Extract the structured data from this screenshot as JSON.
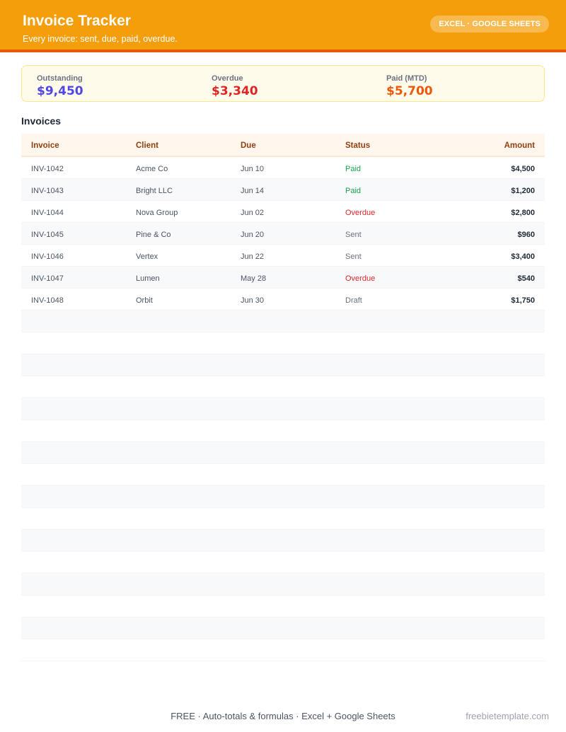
{
  "header": {
    "title": "Invoice Tracker",
    "subtitle": "Every invoice: sent, due, paid, overdue.",
    "badge": "EXCEL · GOOGLE SHEETS",
    "colors": {
      "bar": "#f59e0b",
      "stripe": "#ea580c"
    }
  },
  "summary": [
    {
      "label": "Outstanding",
      "value": "$9,450",
      "color": "#4f46e5"
    },
    {
      "label": "Overdue",
      "value": "$3,340",
      "color": "#dc2626"
    },
    {
      "label": "Paid (MTD)",
      "value": "$5,700",
      "color": "#ea580c"
    }
  ],
  "invoices": {
    "title": "Invoices",
    "columns": [
      "Invoice",
      "Client",
      "Due",
      "Status",
      "Amount"
    ],
    "status_colors": {
      "Paid": "#16a34a",
      "Overdue": "#dc2626",
      "Sent": "#6b7280",
      "Draft": "#6b7280"
    },
    "rows": [
      {
        "invoice": "INV-1042",
        "client": "Acme Co",
        "due": "Jun 10",
        "status": "Paid",
        "amount": "$4,500"
      },
      {
        "invoice": "INV-1043",
        "client": "Bright LLC",
        "due": "Jun 14",
        "status": "Paid",
        "amount": "$1,200"
      },
      {
        "invoice": "INV-1044",
        "client": "Nova Group",
        "due": "Jun 02",
        "status": "Overdue",
        "amount": "$2,800"
      },
      {
        "invoice": "INV-1045",
        "client": "Pine & Co",
        "due": "Jun 20",
        "status": "Sent",
        "amount": "$960"
      },
      {
        "invoice": "INV-1046",
        "client": "Vertex",
        "due": "Jun 22",
        "status": "Sent",
        "amount": "$3,400"
      },
      {
        "invoice": "INV-1047",
        "client": "Lumen",
        "due": "May 28",
        "status": "Overdue",
        "amount": "$540"
      },
      {
        "invoice": "INV-1048",
        "client": "Orbit",
        "due": "Jun 30",
        "status": "Draft",
        "amount": "$1,750"
      }
    ],
    "blank_rows": 16
  },
  "footer": {
    "features": "FREE  ·  Auto-totals & formulas  ·  Excel + Google Sheets",
    "brand": "freebietemplate.com"
  }
}
